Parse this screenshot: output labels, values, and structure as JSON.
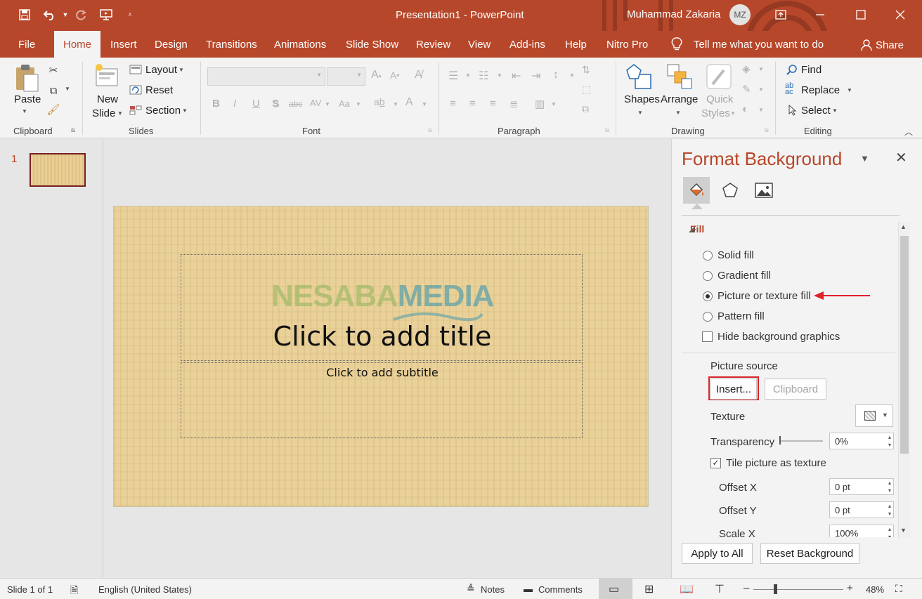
{
  "title_bar": {
    "doc_title": "Presentation1  -  PowerPoint",
    "user_name": "Muhammad Zakaria",
    "avatar_initials": "MZ",
    "qat_icons": [
      "save-icon",
      "undo-icon",
      "redo-icon",
      "present-icon",
      "customize-qat-icon"
    ],
    "window_controls": [
      "ribbon-display-icon",
      "minimize-icon",
      "maximize-icon",
      "close-icon"
    ],
    "accent_color": "#b7472a"
  },
  "tabs": {
    "file": "File",
    "home": "Home",
    "insert": "Insert",
    "design": "Design",
    "transitions": "Transitions",
    "animations": "Animations",
    "slide_show": "Slide Show",
    "review": "Review",
    "view": "View",
    "add_ins": "Add-ins",
    "help": "Help",
    "nitro_pro": "Nitro Pro",
    "tell_me": "Tell me what you want to do",
    "share": "Share"
  },
  "ribbon": {
    "clipboard": {
      "paste": "Paste",
      "label": "Clipboard"
    },
    "slides": {
      "new_slide_line1": "New",
      "new_slide_line2": "Slide",
      "layout": "Layout",
      "reset": "Reset",
      "section": "Section",
      "label": "Slides"
    },
    "font": {
      "label": "Font",
      "bold": "B",
      "italic": "I",
      "underline": "U",
      "shadow": "S",
      "strike": "abc",
      "spacing": "AV",
      "case": "Aa",
      "color": "A"
    },
    "paragraph": {
      "label": "Paragraph"
    },
    "drawing": {
      "shapes": "Shapes",
      "arrange": "Arrange",
      "quick_styles_line1": "Quick",
      "quick_styles_line2": "Styles",
      "label": "Drawing"
    },
    "editing": {
      "find": "Find",
      "replace": "Replace",
      "select": "Select",
      "label": "Editing"
    }
  },
  "thumbnails": {
    "slide_number": "1"
  },
  "slide": {
    "title_placeholder": "Click to add title",
    "subtitle_placeholder": "Click to add subtitle",
    "watermark_part1": "NESABA",
    "watermark_part2": "MEDIA"
  },
  "format_pane": {
    "title": "Format Background",
    "tab_icons": [
      "fill-icon",
      "effects-icon",
      "picture-icon"
    ],
    "section": "Fill",
    "options": {
      "solid": "Solid fill",
      "gradient": "Gradient fill",
      "picture": "Picture or texture fill",
      "pattern": "Pattern fill",
      "hide_graphics": "Hide background graphics"
    },
    "selected_option": "Picture or texture fill",
    "hide_graphics_checked": false,
    "picture_source_label": "Picture source",
    "insert_button": "Insert...",
    "clipboard_button": "Clipboard",
    "texture_label": "Texture",
    "transparency_label": "Transparency",
    "transparency_value": "0%",
    "tile_label": "Tile picture as texture",
    "tile_checked": true,
    "offset_x_label": "Offset X",
    "offset_x_value": "0 pt",
    "offset_y_label": "Offset Y",
    "offset_y_value": "0 pt",
    "scale_x_label": "Scale X",
    "scale_x_value": "100%",
    "apply_all": "Apply to All",
    "reset_bg": "Reset Background",
    "arrow_color": "#e0202a",
    "highlight_color": "#d9262b"
  },
  "status_bar": {
    "slide_info": "Slide 1 of 1",
    "language": "English (United States)",
    "notes": "Notes",
    "comments": "Comments",
    "zoom": "48%",
    "zoom_minus": "–",
    "zoom_plus": "+"
  }
}
